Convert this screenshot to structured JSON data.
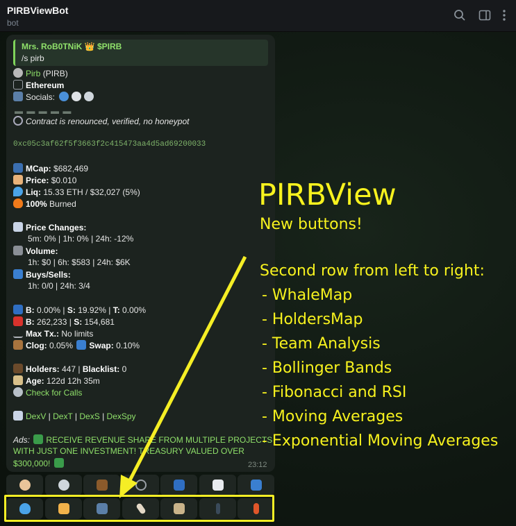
{
  "window": {
    "title": "PIRBViewBot",
    "subtitle": "bot",
    "icons": [
      "search-icon",
      "sidebar-toggle-icon",
      "more-options-icon"
    ]
  },
  "reply": {
    "author": "Mrs. RoB0TNiK 👑 $PIRB",
    "text": "/s pirb"
  },
  "token": {
    "name": "Pirb",
    "symbol": "(PIRB)",
    "chain": "Ethereum",
    "socials_label": "Socials:",
    "contract_status": "Contract is renounced, verified, no honeypot",
    "address": "0xc05c3af62f5f3663f2c415473aa4d5ad69200033"
  },
  "metrics": {
    "mcap_label": "MCap:",
    "mcap": "$682,469",
    "price_label": "Price:",
    "price": "$0.010",
    "liq_label": "Liq:",
    "liq": "15.33 ETH / $32,027 (5%)",
    "burned_pct": "100%",
    "burned_label": "Burned"
  },
  "changes": {
    "price_changes_label": "Price Changes:",
    "price_changes": "5m: 0% | 1h: 0% | 24h: -12%",
    "volume_label": "Volume:",
    "volume": "1h: $0 | 6h: $583 | 24h: $6K",
    "buys_sells_label": "Buys/Sells:",
    "buys_sells": "1h: 0/0 | 24h: 3/4"
  },
  "tax": {
    "b_label": "B:",
    "b": "0.00%",
    "s_label": "S:",
    "s": "19.92%",
    "t_label": "T:",
    "t": "0.00%",
    "b2_label": "B:",
    "b2": "262,233",
    "s2_label": "S:",
    "s2": "154,681",
    "maxtx_label": "Max Tx.:",
    "maxtx": "No limits",
    "clog_label": "Clog:",
    "clog": "0.05%",
    "swap_label": "Swap:",
    "swap": "0.10%"
  },
  "holders": {
    "holders_label": "Holders:",
    "holders": "447",
    "blacklist_label": "Blacklist:",
    "blacklist": "0",
    "age_label": "Age:",
    "age": "122d 12h 35m",
    "calls_link": "Check for Calls"
  },
  "dex_links": [
    "DexV",
    "DexT",
    "DexS",
    "DexSpy"
  ],
  "ad": {
    "label": "Ads:",
    "line1": "RECEIVE REVENUE SHARE FROM MULTIPLE PROJECTS",
    "line2": "WITH JUST ONE INVESTMENT! TREASURY VALUED OVER",
    "line3": "$300,000!"
  },
  "message_time": "23:12",
  "buttons_row1": [
    "bearded-face-icon",
    "eye-icon",
    "briefcase-icon",
    "bubbles-icon",
    "atm-icon",
    "chart-icon",
    "refresh-icon"
  ],
  "buttons_row2": [
    "whale-icon",
    "handshake-icon",
    "team-icon",
    "band-icon",
    "framed-picture-icon",
    "walking-person-icon",
    "running-person-icon"
  ],
  "annotation": {
    "title": "PIRBView",
    "subtitle": "New buttons!",
    "heading": "Second row from left to right:",
    "items": [
      "- WhaleMap",
      "- HoldersMap",
      "- Team Analysis",
      "- Bollinger Bands",
      "- Fibonacci and RSI",
      "- Moving Averages",
      "- Exponential Moving Averages"
    ],
    "highlight_color": "#f5ee25"
  },
  "colors": {
    "link": "#8fe06a",
    "bubble": "#1c231f",
    "annotation": "#f7f21e"
  }
}
